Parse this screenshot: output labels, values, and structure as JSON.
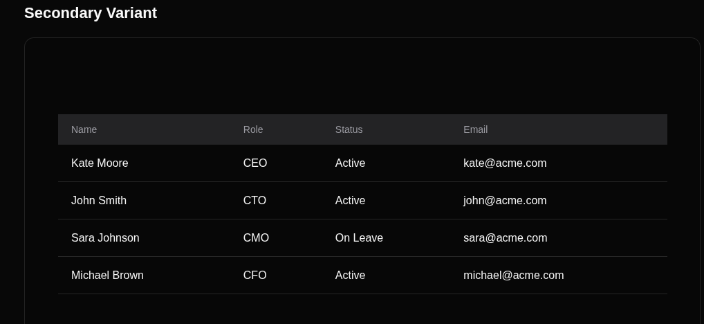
{
  "title": "Secondary Variant",
  "table": {
    "columns": [
      "Name",
      "Role",
      "Status",
      "Email"
    ],
    "rows": [
      {
        "name": "Kate Moore",
        "role": "CEO",
        "status": "Active",
        "email": "kate@acme.com"
      },
      {
        "name": "John Smith",
        "role": "CTO",
        "status": "Active",
        "email": "john@acme.com"
      },
      {
        "name": "Sara Johnson",
        "role": "CMO",
        "status": "On Leave",
        "email": "sara@acme.com"
      },
      {
        "name": "Michael Brown",
        "role": "CFO",
        "status": "Active",
        "email": "michael@acme.com"
      }
    ]
  }
}
